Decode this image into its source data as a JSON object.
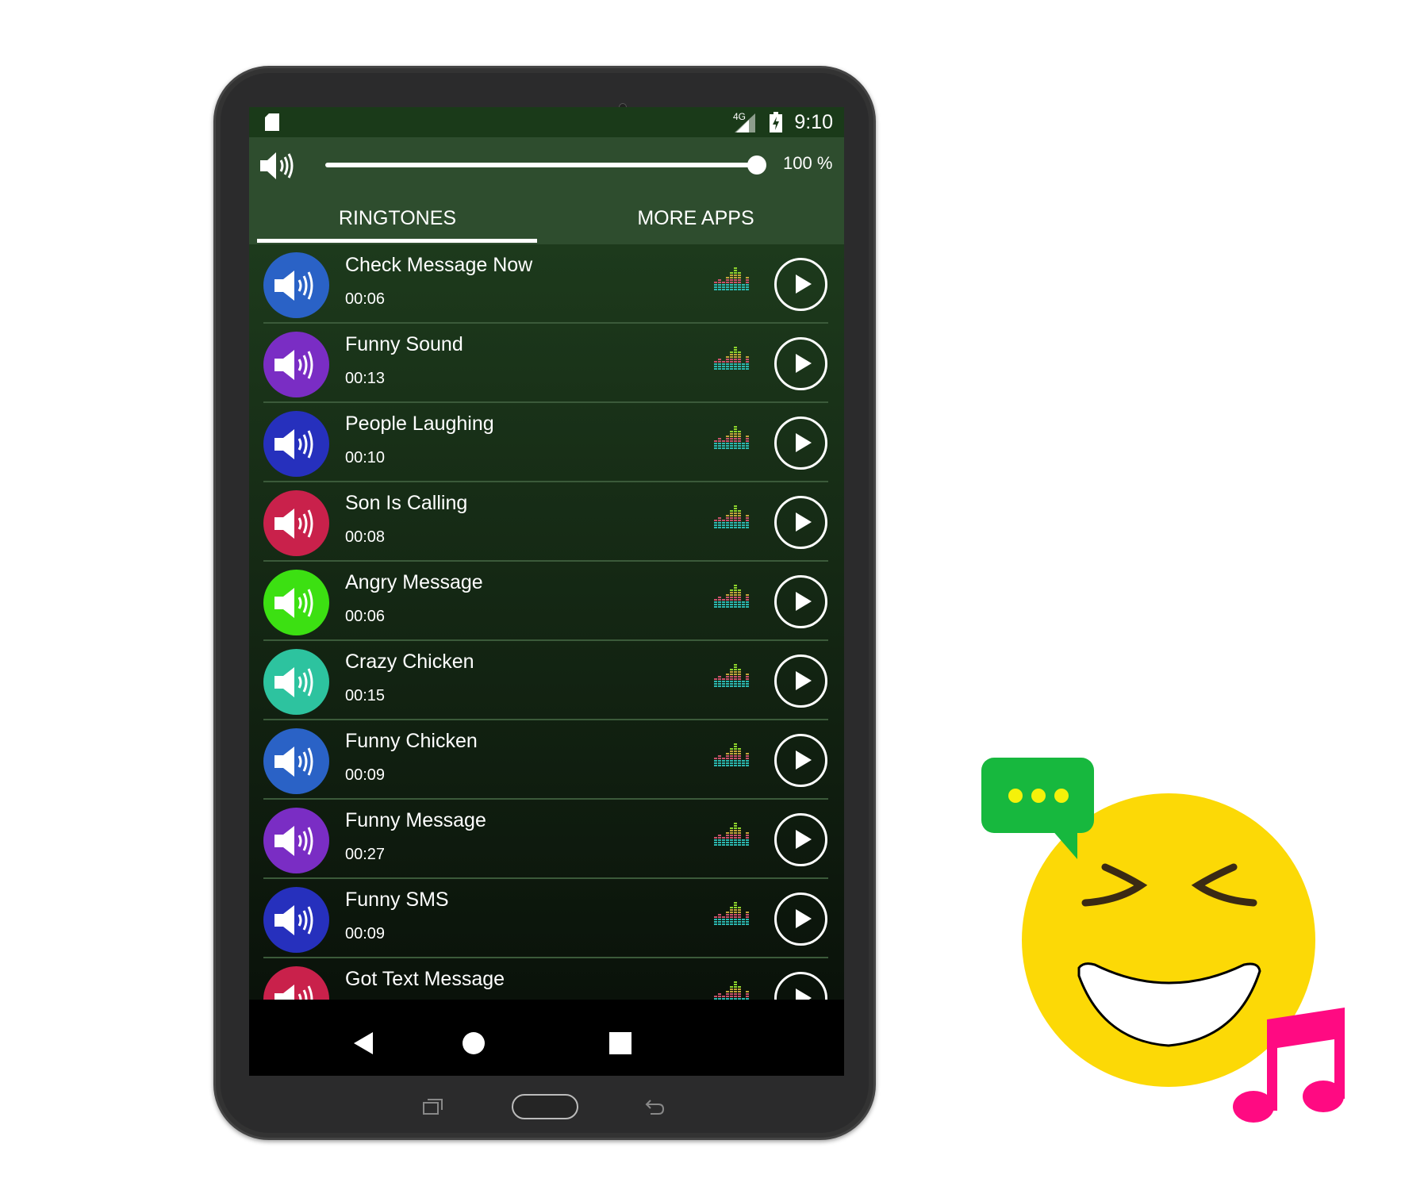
{
  "status_bar": {
    "network": "4G",
    "time": "9:10",
    "icons": [
      "sd-card-icon",
      "signal-icon",
      "battery-charging-icon"
    ]
  },
  "volume": {
    "percent_label": "100 %",
    "level": 1.0
  },
  "tabs": [
    {
      "label": "RINGTONES",
      "active": true
    },
    {
      "label": "MORE APPS",
      "active": false
    }
  ],
  "ringtones": [
    {
      "title": "Check Message Now",
      "duration": "00:06",
      "color": "#2a62c6"
    },
    {
      "title": "Funny Sound",
      "duration": "00:13",
      "color": "#7a2dc4"
    },
    {
      "title": "People Laughing",
      "duration": "00:10",
      "color": "#2630bd"
    },
    {
      "title": "Son Is Calling",
      "duration": "00:08",
      "color": "#c9214b"
    },
    {
      "title": "Angry Message",
      "duration": "00:06",
      "color": "#3ce012"
    },
    {
      "title": "Crazy Chicken",
      "duration": "00:15",
      "color": "#2dc39f"
    },
    {
      "title": "Funny Chicken",
      "duration": "00:09",
      "color": "#2a62c6"
    },
    {
      "title": "Funny Message",
      "duration": "00:27",
      "color": "#7a2dc4"
    },
    {
      "title": "Funny SMS",
      "duration": "00:09",
      "color": "#2630bd"
    },
    {
      "title": "Got Text Message",
      "duration": "",
      "color": "#c9214b"
    }
  ],
  "nav_bar": {
    "icons": [
      "back-icon",
      "home-icon",
      "recents-icon"
    ]
  },
  "colors": {
    "status_bar": "#1a3a19",
    "header": "#2e4d2e",
    "list_top": "#1d3a1c",
    "emoji_yellow": "#fcd906",
    "bubble_green": "#17b83e",
    "note_pink": "#ff0a82"
  }
}
